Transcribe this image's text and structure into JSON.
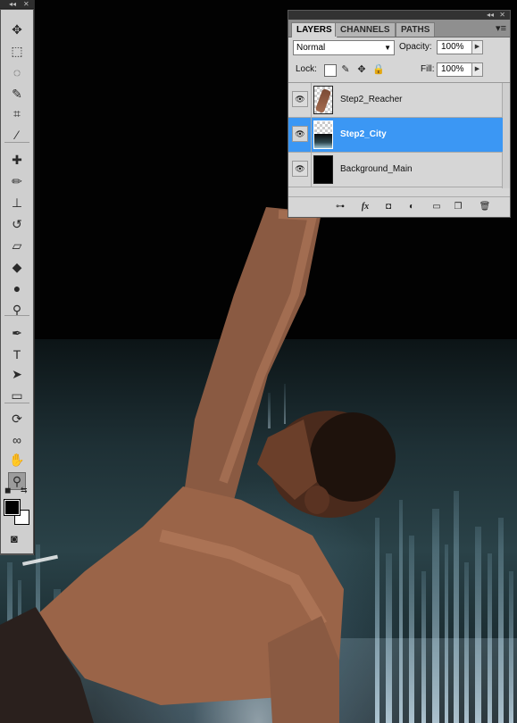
{
  "tools_panel": {
    "collapse_glyph": "◂◂",
    "close_glyph": "✕",
    "tools": [
      {
        "name": "move-tool-icon",
        "glyph": "✥"
      },
      {
        "name": "marquee-tool-icon",
        "glyph": "⬚"
      },
      {
        "name": "lasso-tool-icon",
        "glyph": "◌"
      },
      {
        "name": "quick-selection-tool-icon",
        "glyph": "✎"
      },
      {
        "name": "crop-tool-icon",
        "glyph": "⌗"
      },
      {
        "name": "eyedropper-tool-icon",
        "glyph": "⁄"
      },
      {
        "name": "healing-brush-tool-icon",
        "glyph": "✚"
      },
      {
        "name": "brush-tool-icon",
        "glyph": "✏"
      },
      {
        "name": "clone-stamp-tool-icon",
        "glyph": "⊥"
      },
      {
        "name": "history-brush-tool-icon",
        "glyph": "↺"
      },
      {
        "name": "eraser-tool-icon",
        "glyph": "▱"
      },
      {
        "name": "paint-bucket-tool-icon",
        "glyph": "◆"
      },
      {
        "name": "blur-tool-icon",
        "glyph": "●"
      },
      {
        "name": "dodge-tool-icon",
        "glyph": "⚲"
      },
      {
        "name": "pen-tool-icon",
        "glyph": "✒"
      },
      {
        "name": "type-tool-icon",
        "glyph": "T"
      },
      {
        "name": "path-selection-tool-icon",
        "glyph": "➤"
      },
      {
        "name": "rectangle-tool-icon",
        "glyph": "▭"
      },
      {
        "name": "3d-rotate-tool-icon",
        "glyph": "⟳"
      },
      {
        "name": "3d-orbit-tool-icon",
        "glyph": "∞"
      },
      {
        "name": "hand-tool-icon",
        "glyph": "✋"
      },
      {
        "name": "zoom-tool-icon",
        "glyph": "⚲"
      }
    ],
    "active_tool": "zoom-tool-icon",
    "foreground_color": "#000000",
    "background_color": "#ffffff",
    "default_colors_glyph": "◼",
    "swap_colors_glyph": "⇆",
    "quick_mask_glyph": "◙"
  },
  "layers_panel": {
    "collapse_glyph": "◂◂",
    "close_glyph": "✕",
    "tabs": [
      "LAYERS",
      "CHANNELS",
      "PATHS"
    ],
    "active_tab": "LAYERS",
    "menu_glyph": "▾≡",
    "blend_mode": "Normal",
    "opacity_label": "Opacity:",
    "opacity_value": "100%",
    "lock_label": "Lock:",
    "fill_label": "Fill:",
    "fill_value": "100%",
    "lock_icons": [
      "lock-transparency-icon",
      "lock-pixels-icon",
      "lock-position-icon",
      "lock-all-icon"
    ],
    "layers": [
      {
        "name": "Step2_Reacher",
        "visible": true,
        "selected": false,
        "thumb": "checker"
      },
      {
        "name": "Step2_City",
        "visible": true,
        "selected": true,
        "thumb": "checker-city"
      },
      {
        "name": "Background_Main",
        "visible": true,
        "selected": false,
        "thumb": "black"
      }
    ],
    "bottom_icons": [
      {
        "name": "link-layers-icon",
        "glyph": "⊶"
      },
      {
        "name": "layer-style-icon",
        "glyph": "fx"
      },
      {
        "name": "layer-mask-icon",
        "glyph": "◘"
      },
      {
        "name": "adjustment-layer-icon",
        "glyph": "◐"
      },
      {
        "name": "new-group-icon",
        "glyph": "▭"
      },
      {
        "name": "new-layer-icon",
        "glyph": "❐"
      },
      {
        "name": "delete-layer-icon",
        "glyph": "🗑"
      }
    ]
  },
  "colors": {
    "selection_blue": "#3b97f4",
    "panel_gray": "#d6d6d6"
  }
}
